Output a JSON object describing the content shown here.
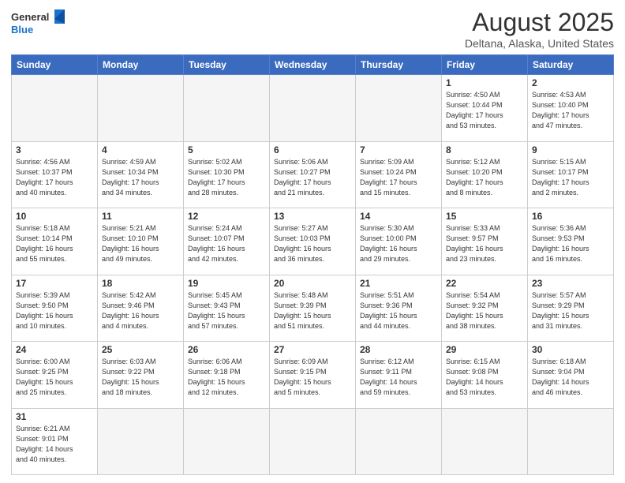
{
  "header": {
    "logo_general": "General",
    "logo_blue": "Blue",
    "title": "August 2025",
    "subtitle": "Deltana, Alaska, United States"
  },
  "weekdays": [
    "Sunday",
    "Monday",
    "Tuesday",
    "Wednesday",
    "Thursday",
    "Friday",
    "Saturday"
  ],
  "weeks": [
    [
      {
        "day": "",
        "info": ""
      },
      {
        "day": "",
        "info": ""
      },
      {
        "day": "",
        "info": ""
      },
      {
        "day": "",
        "info": ""
      },
      {
        "day": "",
        "info": ""
      },
      {
        "day": "1",
        "info": "Sunrise: 4:50 AM\nSunset: 10:44 PM\nDaylight: 17 hours\nand 53 minutes."
      },
      {
        "day": "2",
        "info": "Sunrise: 4:53 AM\nSunset: 10:40 PM\nDaylight: 17 hours\nand 47 minutes."
      }
    ],
    [
      {
        "day": "3",
        "info": "Sunrise: 4:56 AM\nSunset: 10:37 PM\nDaylight: 17 hours\nand 40 minutes."
      },
      {
        "day": "4",
        "info": "Sunrise: 4:59 AM\nSunset: 10:34 PM\nDaylight: 17 hours\nand 34 minutes."
      },
      {
        "day": "5",
        "info": "Sunrise: 5:02 AM\nSunset: 10:30 PM\nDaylight: 17 hours\nand 28 minutes."
      },
      {
        "day": "6",
        "info": "Sunrise: 5:06 AM\nSunset: 10:27 PM\nDaylight: 17 hours\nand 21 minutes."
      },
      {
        "day": "7",
        "info": "Sunrise: 5:09 AM\nSunset: 10:24 PM\nDaylight: 17 hours\nand 15 minutes."
      },
      {
        "day": "8",
        "info": "Sunrise: 5:12 AM\nSunset: 10:20 PM\nDaylight: 17 hours\nand 8 minutes."
      },
      {
        "day": "9",
        "info": "Sunrise: 5:15 AM\nSunset: 10:17 PM\nDaylight: 17 hours\nand 2 minutes."
      }
    ],
    [
      {
        "day": "10",
        "info": "Sunrise: 5:18 AM\nSunset: 10:14 PM\nDaylight: 16 hours\nand 55 minutes."
      },
      {
        "day": "11",
        "info": "Sunrise: 5:21 AM\nSunset: 10:10 PM\nDaylight: 16 hours\nand 49 minutes."
      },
      {
        "day": "12",
        "info": "Sunrise: 5:24 AM\nSunset: 10:07 PM\nDaylight: 16 hours\nand 42 minutes."
      },
      {
        "day": "13",
        "info": "Sunrise: 5:27 AM\nSunset: 10:03 PM\nDaylight: 16 hours\nand 36 minutes."
      },
      {
        "day": "14",
        "info": "Sunrise: 5:30 AM\nSunset: 10:00 PM\nDaylight: 16 hours\nand 29 minutes."
      },
      {
        "day": "15",
        "info": "Sunrise: 5:33 AM\nSunset: 9:57 PM\nDaylight: 16 hours\nand 23 minutes."
      },
      {
        "day": "16",
        "info": "Sunrise: 5:36 AM\nSunset: 9:53 PM\nDaylight: 16 hours\nand 16 minutes."
      }
    ],
    [
      {
        "day": "17",
        "info": "Sunrise: 5:39 AM\nSunset: 9:50 PM\nDaylight: 16 hours\nand 10 minutes."
      },
      {
        "day": "18",
        "info": "Sunrise: 5:42 AM\nSunset: 9:46 PM\nDaylight: 16 hours\nand 4 minutes."
      },
      {
        "day": "19",
        "info": "Sunrise: 5:45 AM\nSunset: 9:43 PM\nDaylight: 15 hours\nand 57 minutes."
      },
      {
        "day": "20",
        "info": "Sunrise: 5:48 AM\nSunset: 9:39 PM\nDaylight: 15 hours\nand 51 minutes."
      },
      {
        "day": "21",
        "info": "Sunrise: 5:51 AM\nSunset: 9:36 PM\nDaylight: 15 hours\nand 44 minutes."
      },
      {
        "day": "22",
        "info": "Sunrise: 5:54 AM\nSunset: 9:32 PM\nDaylight: 15 hours\nand 38 minutes."
      },
      {
        "day": "23",
        "info": "Sunrise: 5:57 AM\nSunset: 9:29 PM\nDaylight: 15 hours\nand 31 minutes."
      }
    ],
    [
      {
        "day": "24",
        "info": "Sunrise: 6:00 AM\nSunset: 9:25 PM\nDaylight: 15 hours\nand 25 minutes."
      },
      {
        "day": "25",
        "info": "Sunrise: 6:03 AM\nSunset: 9:22 PM\nDaylight: 15 hours\nand 18 minutes."
      },
      {
        "day": "26",
        "info": "Sunrise: 6:06 AM\nSunset: 9:18 PM\nDaylight: 15 hours\nand 12 minutes."
      },
      {
        "day": "27",
        "info": "Sunrise: 6:09 AM\nSunset: 9:15 PM\nDaylight: 15 hours\nand 5 minutes."
      },
      {
        "day": "28",
        "info": "Sunrise: 6:12 AM\nSunset: 9:11 PM\nDaylight: 14 hours\nand 59 minutes."
      },
      {
        "day": "29",
        "info": "Sunrise: 6:15 AM\nSunset: 9:08 PM\nDaylight: 14 hours\nand 53 minutes."
      },
      {
        "day": "30",
        "info": "Sunrise: 6:18 AM\nSunset: 9:04 PM\nDaylight: 14 hours\nand 46 minutes."
      }
    ],
    [
      {
        "day": "31",
        "info": "Sunrise: 6:21 AM\nSunset: 9:01 PM\nDaylight: 14 hours\nand 40 minutes."
      },
      {
        "day": "",
        "info": ""
      },
      {
        "day": "",
        "info": ""
      },
      {
        "day": "",
        "info": ""
      },
      {
        "day": "",
        "info": ""
      },
      {
        "day": "",
        "info": ""
      },
      {
        "day": "",
        "info": ""
      }
    ]
  ]
}
